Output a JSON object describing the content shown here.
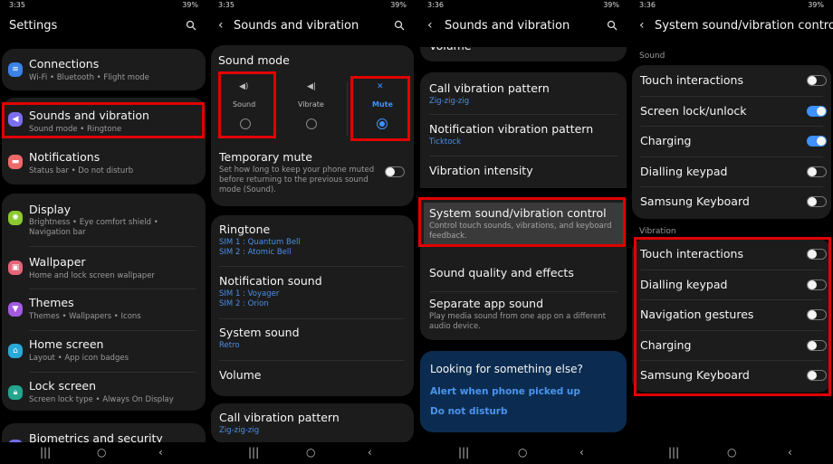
{
  "panels": [
    {
      "status": {
        "time": "3:35",
        "right": "39%"
      },
      "header": {
        "title": "Settings"
      },
      "items": [
        {
          "title": "Connections",
          "subtitle": "Wi-Fi  •  Bluetooth  •  Flight mode",
          "icon": "wifi-icon",
          "color": "#3b82e6"
        },
        {
          "title": "Sounds and vibration",
          "subtitle": "Sound mode  •  Ringtone",
          "icon": "speaker-icon",
          "color": "#7b6ef0"
        },
        {
          "title": "Notifications",
          "subtitle": "Status bar  •  Do not disturb",
          "icon": "notification-icon",
          "color": "#ee6a6a"
        },
        {
          "title": "Display",
          "subtitle": "Brightness  •  Eye comfort shield  •  Navigation bar",
          "icon": "sun-icon",
          "color": "#8cc830"
        },
        {
          "title": "Wallpaper",
          "subtitle": "Home and lock screen wallpaper",
          "icon": "wallpaper-icon",
          "color": "#e8647a"
        },
        {
          "title": "Themes",
          "subtitle": "Themes  •  Wallpapers  •  Icons",
          "icon": "theme-icon",
          "color": "#a25be0"
        },
        {
          "title": "Home screen",
          "subtitle": "Layout  •  App icon badges",
          "icon": "home-icon",
          "color": "#2aa8d8"
        },
        {
          "title": "Lock screen",
          "subtitle": "Screen lock type  •  Always On Display",
          "icon": "lock-icon",
          "color": "#23a58e"
        },
        {
          "title": "Biometrics and security",
          "subtitle": "",
          "icon": "shield-icon",
          "color": "#6e6ef0"
        }
      ]
    },
    {
      "status": {
        "time": "3:35",
        "right": "39%"
      },
      "header": {
        "title": "Sounds and vibration"
      },
      "sound_mode": {
        "title": "Sound mode",
        "options": [
          {
            "label": "Sound",
            "selected": false
          },
          {
            "label": "Vibrate",
            "selected": false
          },
          {
            "label": "Mute",
            "selected": true
          }
        ]
      },
      "temporary_mute": {
        "title": "Temporary mute",
        "desc": "Set how long to keep your phone muted before returning to the previous sound mode (Sound).",
        "on": false
      },
      "items": [
        {
          "title": "Ringtone",
          "values": [
            "SIM 1 : Quantum Bell",
            "SIM 2 : Atomic Bell"
          ]
        },
        {
          "title": "Notification sound",
          "values": [
            "SIM 1 : Voyager",
            "SIM 2 : Orion"
          ]
        },
        {
          "title": "System sound",
          "values": [
            "Retro"
          ]
        },
        {
          "title": "Volume",
          "values": []
        },
        {
          "title": "Call vibration pattern",
          "values": [
            "Zig-zig-zig"
          ]
        }
      ]
    },
    {
      "status": {
        "time": "3:36",
        "right": "39%"
      },
      "header": {
        "title": "Sounds and vibration"
      },
      "items": [
        {
          "title": "Volume",
          "sub": ""
        },
        {
          "title": "Call vibration pattern",
          "value": "Zig-zig-zig"
        },
        {
          "title": "Notification vibration pattern",
          "value": "Ticktock"
        },
        {
          "title": "Vibration intensity",
          "value": ""
        },
        {
          "title": "System sound/vibration control",
          "sub": "Control touch sounds, vibrations, and keyboard feedback."
        },
        {
          "title": "Sound quality and effects",
          "sub": ""
        },
        {
          "title": "Separate app sound",
          "sub": "Play media sound from one app on a different audio device."
        }
      ],
      "looking": {
        "title": "Looking for something else?",
        "links": [
          "Alert when phone picked up",
          "Do not disturb"
        ]
      }
    },
    {
      "status": {
        "time": "3:36",
        "right": "39%"
      },
      "header": {
        "title": "System sound/vibration control"
      },
      "sound_label": "Sound",
      "sound": [
        {
          "label": "Touch interactions",
          "on": false
        },
        {
          "label": "Screen lock/unlock",
          "on": true
        },
        {
          "label": "Charging",
          "on": true
        },
        {
          "label": "Dialling keypad",
          "on": false
        },
        {
          "label": "Samsung Keyboard",
          "on": false
        }
      ],
      "vibration_label": "Vibration",
      "vibration": [
        {
          "label": "Touch interactions",
          "on": false
        },
        {
          "label": "Dialling keypad",
          "on": false
        },
        {
          "label": "Navigation gestures",
          "on": false
        },
        {
          "label": "Charging",
          "on": false
        },
        {
          "label": "Samsung Keyboard",
          "on": false
        }
      ]
    }
  ],
  "navbar": {
    "recents": "|||",
    "home": "○",
    "back": "‹"
  },
  "accent": "#3e91ff",
  "highlight_color": "#e30000"
}
